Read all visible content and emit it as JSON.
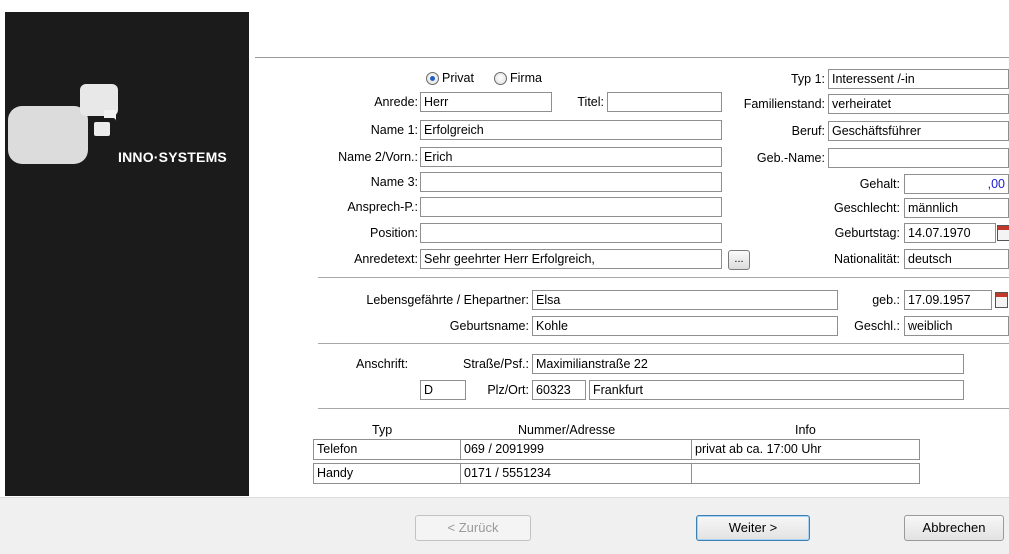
{
  "brand": "INNO·SYSTEMS",
  "radios": [
    {
      "label": "Privat",
      "checked": true
    },
    {
      "label": "Firma",
      "checked": false
    }
  ],
  "left": {
    "anrede_label": "Anrede:",
    "anrede": "Herr",
    "titel_label": "Titel:",
    "titel": "",
    "name1_label": "Name 1:",
    "name1": "Erfolgreich",
    "name2_label": "Name 2/Vorn.:",
    "name2": "Erich",
    "name3_label": "Name 3:",
    "name3": "",
    "ansprech_label": "Ansprech-P.:",
    "ansprech": "",
    "position_label": "Position:",
    "position": "",
    "anredetext_label": "Anredetext:",
    "anredetext": "Sehr geehrter Herr Erfolgreich,",
    "dots_label": "..."
  },
  "right": {
    "typ1_label": "Typ 1:",
    "typ1": "Interessent /-in",
    "familienstand_label": "Familienstand:",
    "familienstand": "verheiratet",
    "beruf_label": "Beruf:",
    "beruf": "Geschäftsführer",
    "gebname_label": "Geb.-Name:",
    "gebname": "",
    "gehalt_label": "Gehalt:",
    "gehalt": ",00",
    "geschlecht_label": "Geschlecht:",
    "geschlecht": "männlich",
    "geburtstag_label": "Geburtstag:",
    "geburtstag": "14.07.1970",
    "nationalitaet_label": "Nationalität:",
    "nationalitaet": "deutsch"
  },
  "partner": {
    "partner_label": "Lebensgefährte / Ehepartner:",
    "partner": "Elsa",
    "geb_label": "geb.:",
    "geb": "17.09.1957",
    "geburtsname_label": "Geburtsname:",
    "geburtsname": "Kohle",
    "geschl_label": "Geschl.:",
    "geschl": "weiblich"
  },
  "address": {
    "anschrift_label": "Anschrift:",
    "strasse_label": "Straße/Psf.:",
    "strasse": "Maximilianstraße 22",
    "land": "D",
    "plzort_label": "Plz/Ort:",
    "plz": "60323",
    "ort": "Frankfurt"
  },
  "contacts": {
    "headers": [
      "Typ",
      "Nummer/Adresse",
      "Info"
    ],
    "rows": [
      {
        "typ": "Telefon",
        "nummer": "069 / 2091999",
        "info": "privat ab ca. 17:00 Uhr"
      },
      {
        "typ": "Handy",
        "nummer": "0171 / 5551234",
        "info": ""
      }
    ]
  },
  "buttons": {
    "back": "< Zurück",
    "next": "Weiter >",
    "cancel": "Abbrechen"
  },
  "colors": {
    "sidebar": "#1b1b1b",
    "accent_blue": "#1e5fbf"
  }
}
